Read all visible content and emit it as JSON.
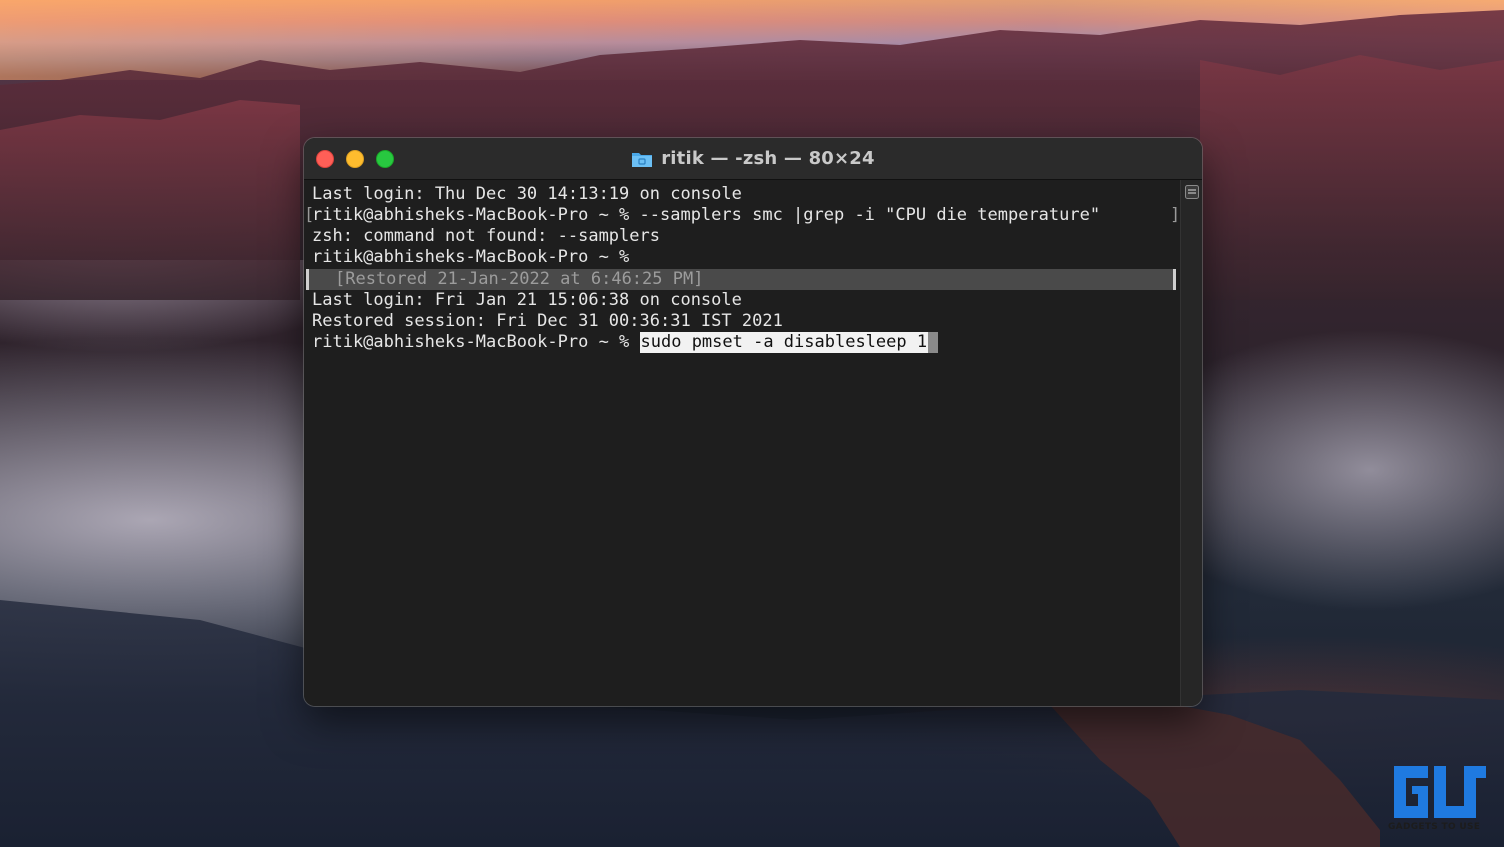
{
  "window": {
    "title": "ritik — -zsh — 80×24",
    "folder_icon": "folder-icon"
  },
  "terminal": {
    "line1": "Last login: Thu Dec 30 14:13:19 on console",
    "line2": "ritik@abhisheks-MacBook-Pro ~ % --samplers smc |grep -i \"CPU die temperature\"",
    "line3": "zsh: command not found: --samplers",
    "line4": "ritik@abhisheks-MacBook-Pro ~ %",
    "restored_banner": "[Restored 21-Jan-2022 at 6:46:25 PM]",
    "line5": "Last login: Fri Jan 21 15:06:38 on console",
    "line6": "Restored session: Fri Dec 31 00:36:31 IST 2021",
    "prompt": "ritik@abhisheks-MacBook-Pro ~ % ",
    "selected_command": "sudo pmset -a disablesleep 1"
  },
  "watermark": {
    "caption": "GADGETS TO USE"
  },
  "colors": {
    "terminal_bg": "#1e1e1e",
    "close": "#ff5f57",
    "minimize": "#febc2e",
    "maximize": "#28c840",
    "logo_blue": "#1f7ae0"
  }
}
